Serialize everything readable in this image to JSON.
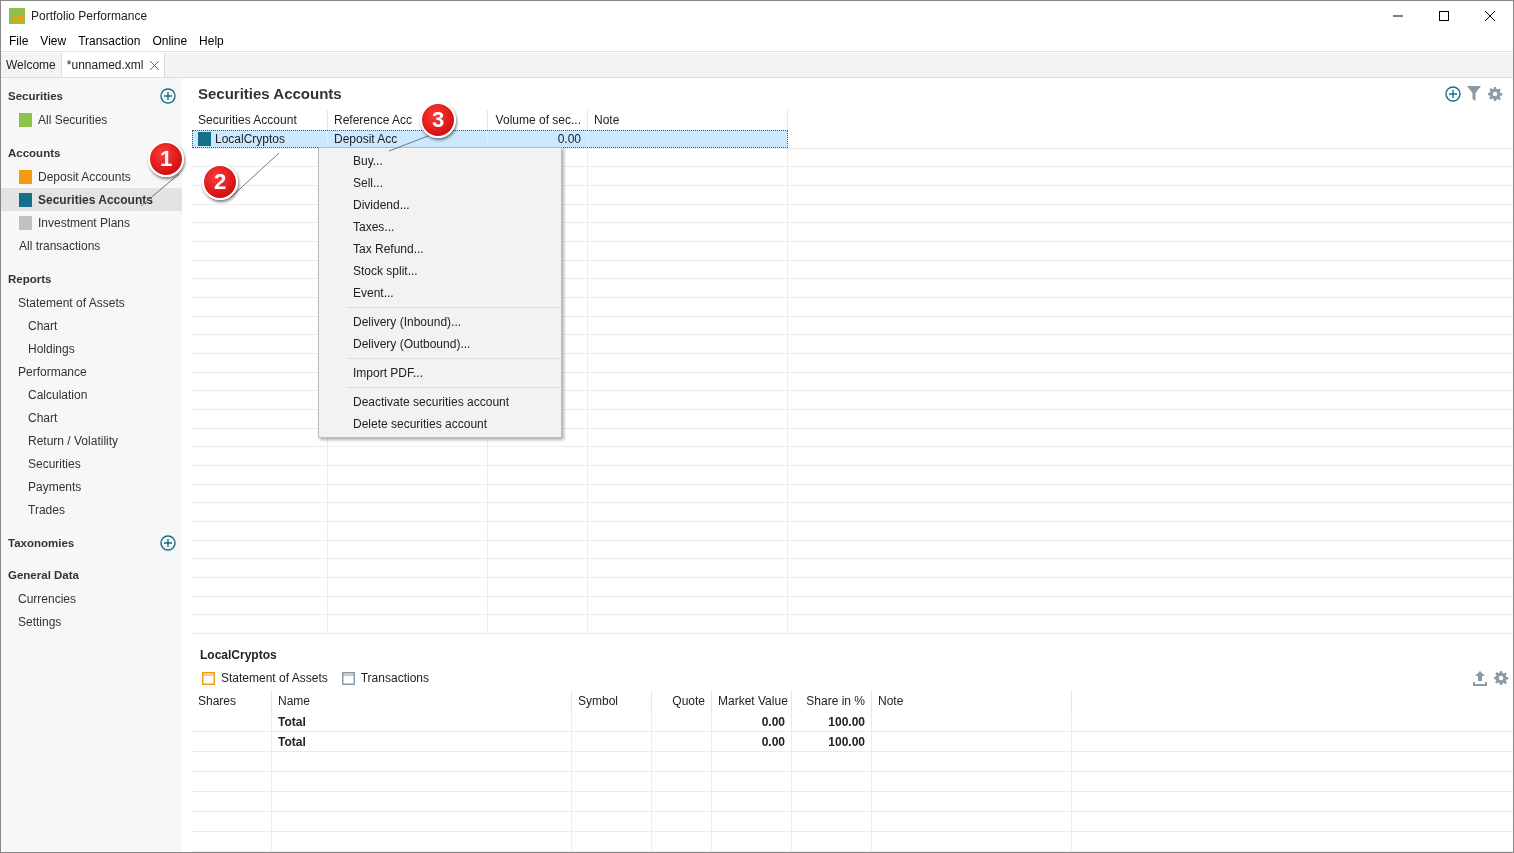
{
  "window": {
    "title": "Portfolio Performance"
  },
  "menu": [
    "File",
    "View",
    "Transaction",
    "Online",
    "Help"
  ],
  "tabs": [
    {
      "label": "Welcome",
      "selected": false,
      "closable": false
    },
    {
      "label": "*unnamed.xml",
      "selected": true,
      "closable": true
    }
  ],
  "sidebar": {
    "sections": [
      {
        "title": "Securities",
        "add": true,
        "items": [
          {
            "label": "All Securities",
            "color": "#8bc34a",
            "selected": false
          }
        ]
      },
      {
        "title": "Accounts",
        "add": false,
        "items": [
          {
            "label": "Deposit Accounts",
            "color": "#f39c12",
            "selected": false
          },
          {
            "label": "Securities Accounts",
            "color": "#136f8a",
            "selected": true
          },
          {
            "label": "Investment Plans",
            "color": "#c0c0c0",
            "selected": false
          },
          {
            "label": "All transactions",
            "selected": false
          }
        ]
      },
      {
        "title": "Reports",
        "add": false,
        "items": [
          {
            "label": "Statement of Assets",
            "selected": false,
            "children": [
              {
                "label": "Chart",
                "selected": false
              },
              {
                "label": "Holdings",
                "selected": false
              }
            ]
          },
          {
            "label": "Performance",
            "selected": false,
            "children": [
              {
                "label": "Calculation",
                "selected": false
              },
              {
                "label": "Chart",
                "selected": false
              },
              {
                "label": "Return / Volatility",
                "selected": false
              },
              {
                "label": "Securities",
                "selected": false
              },
              {
                "label": "Payments",
                "selected": false
              },
              {
                "label": "Trades",
                "selected": false
              }
            ]
          }
        ]
      },
      {
        "title": "Taxonomies",
        "add": true
      },
      {
        "title": "General Data",
        "add": false,
        "items": [
          {
            "label": "Currencies",
            "selected": false
          },
          {
            "label": "Settings",
            "selected": false
          }
        ]
      }
    ]
  },
  "main": {
    "title": "Securities Accounts",
    "table": {
      "columns": [
        "Securities Account",
        "Reference Acc",
        "Volume of sec...",
        "Note"
      ],
      "rows": [
        {
          "selected": true,
          "color": "#136f8a",
          "cells": [
            "LocalCryptos",
            "Deposit Acc",
            "0.00",
            ""
          ]
        }
      ]
    }
  },
  "context_menu": {
    "groups": [
      [
        "Buy...",
        "Sell...",
        "Dividend...",
        "Taxes...",
        "Tax Refund...",
        "Stock split...",
        "Event..."
      ],
      [
        "Delivery (Inbound)...",
        "Delivery (Outbound)..."
      ],
      [
        "Import PDF..."
      ],
      [
        "Deactivate securities account",
        "Delete securities account"
      ]
    ]
  },
  "callouts": [
    "1",
    "2",
    "3"
  ],
  "detail": {
    "title": "LocalCryptos",
    "tabs": [
      {
        "label": "Statement of Assets",
        "selected": true
      },
      {
        "label": "Transactions",
        "selected": false
      }
    ],
    "columns": [
      "Shares",
      "Name",
      "Symbol",
      "Quote",
      "Market Value",
      "Share in %",
      "Note"
    ],
    "rows": [
      [
        "",
        "Total",
        "",
        "",
        "0.00",
        "100.00",
        ""
      ],
      [
        "",
        "Total",
        "",
        "",
        "0.00",
        "100.00",
        ""
      ]
    ]
  }
}
